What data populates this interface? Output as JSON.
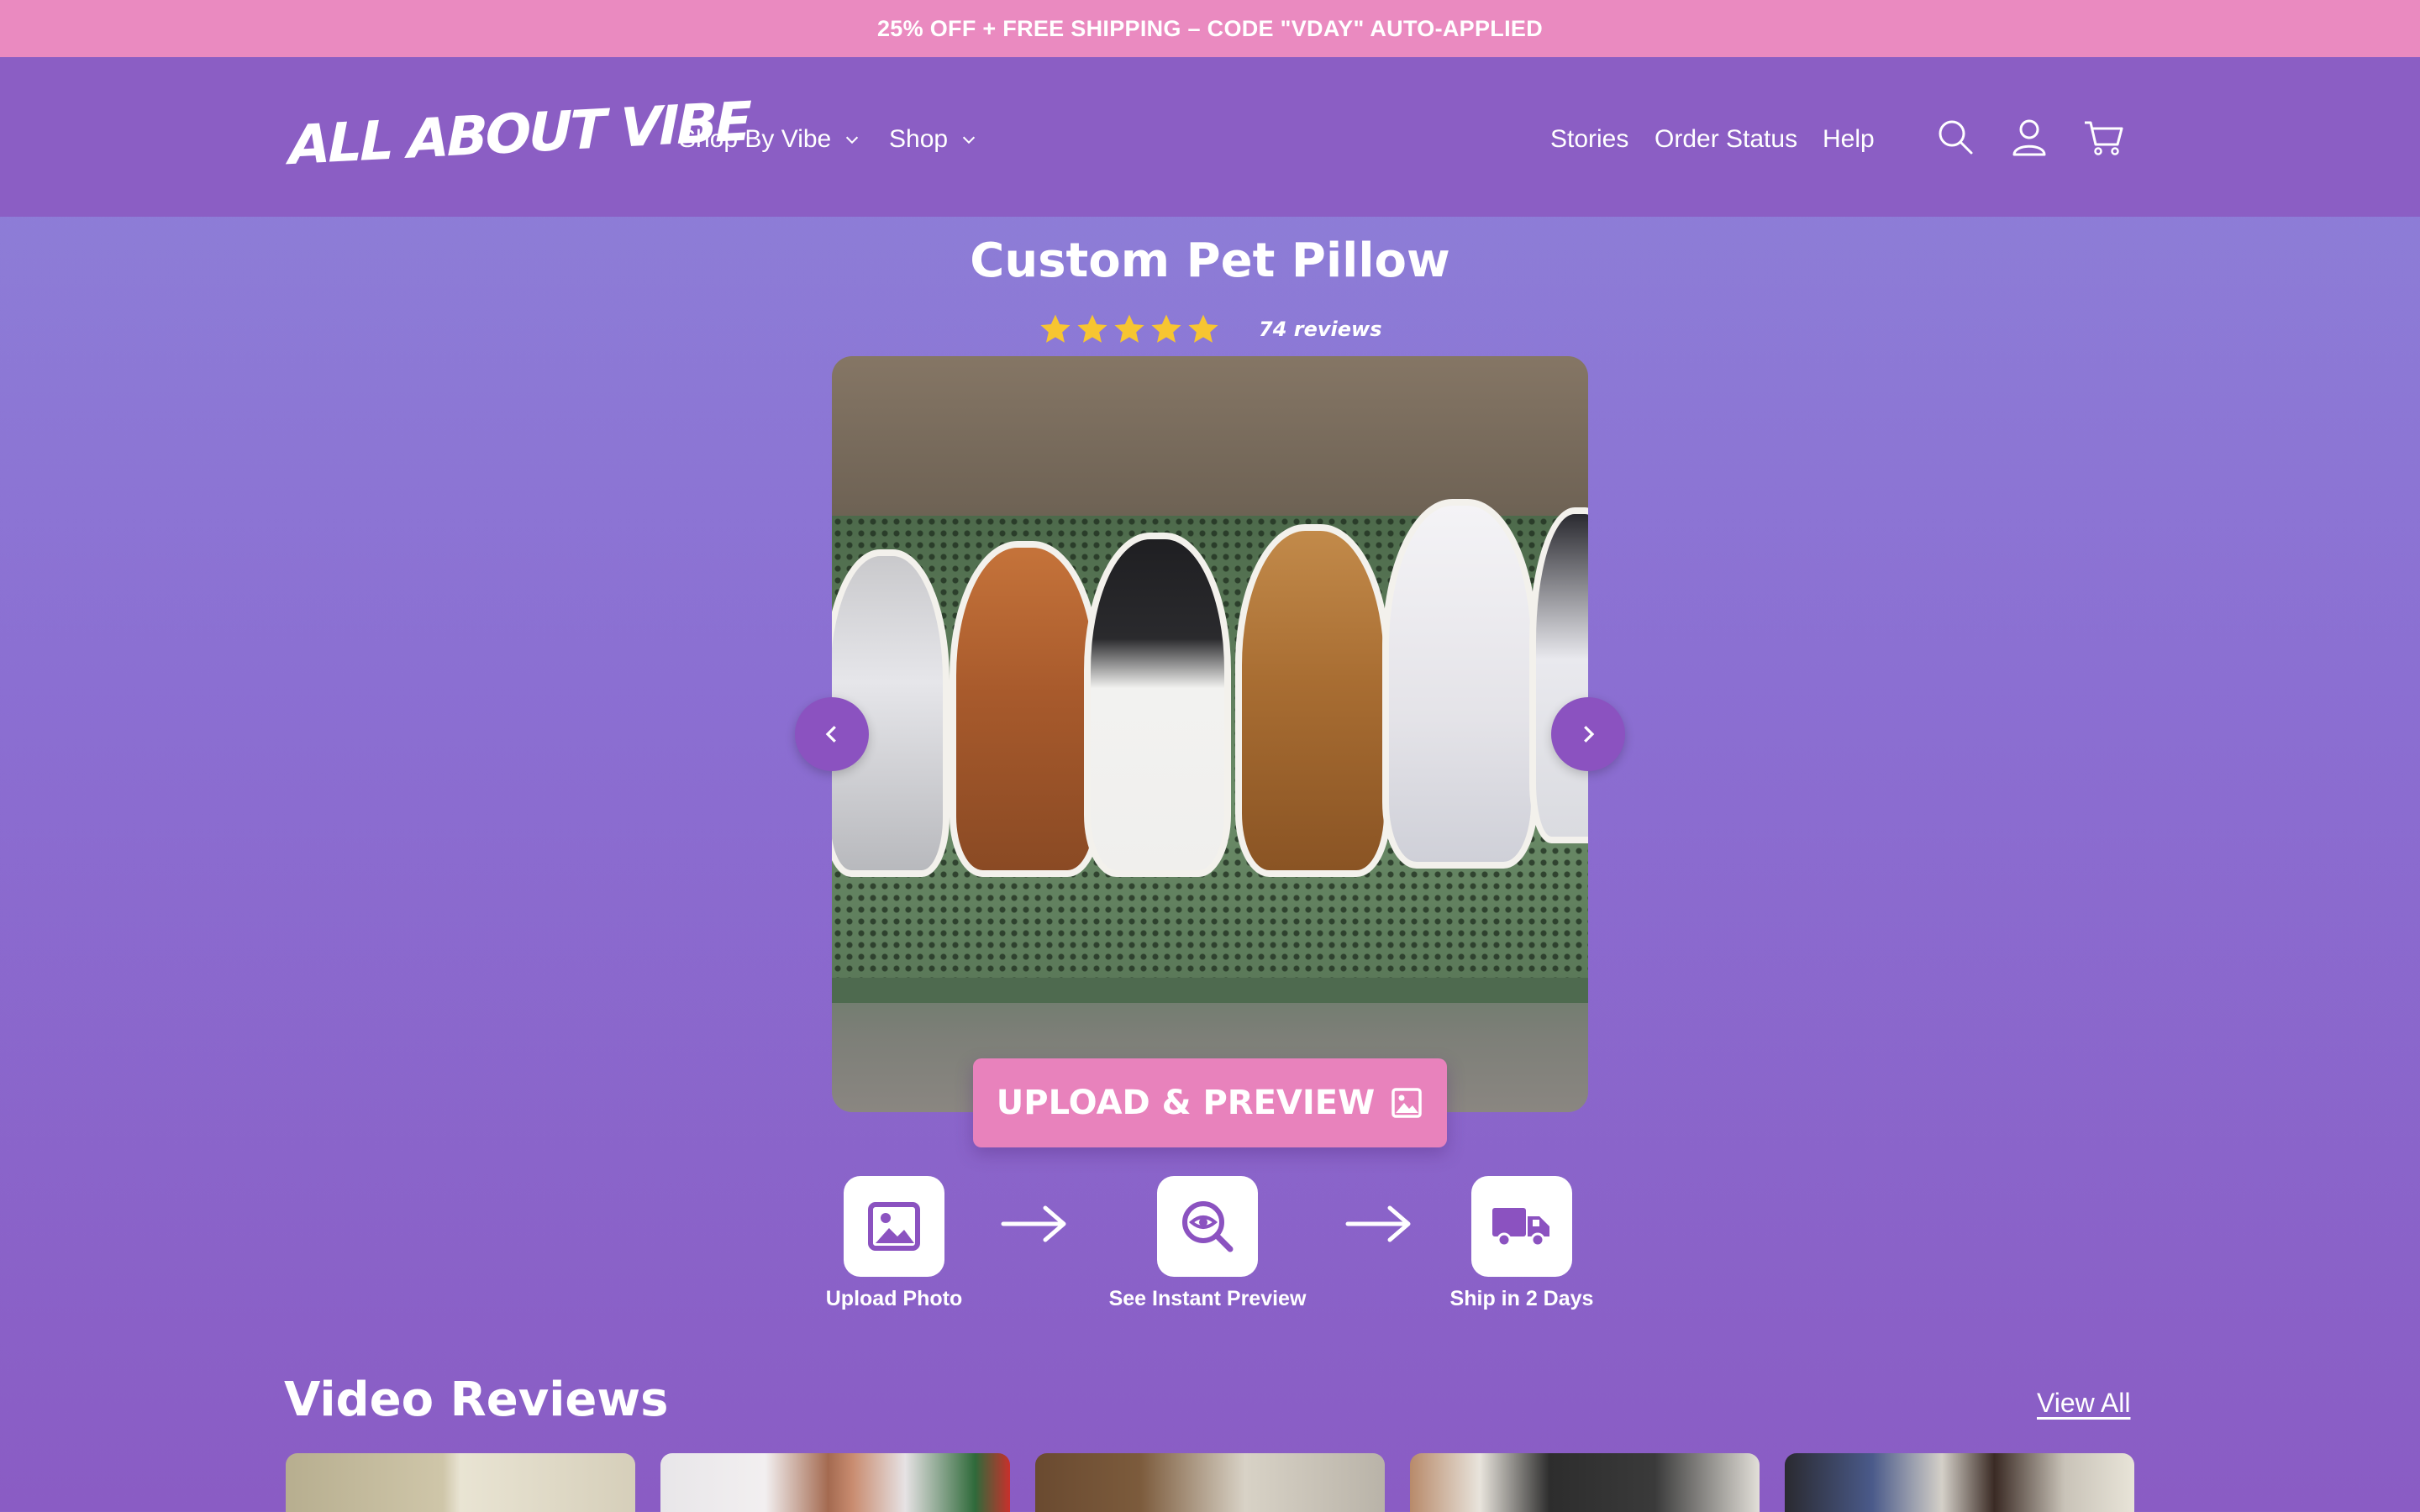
{
  "announcement": "25% OFF + FREE SHIPPING – CODE \"VDAY\" AUTO-APPLIED",
  "header": {
    "logo": "ALL ABOUT VIBE",
    "nav": [
      "Shop By Vibe",
      "Shop"
    ],
    "links": [
      "Stories",
      "Order Status",
      "Help"
    ],
    "icons": [
      "search-icon",
      "account-icon",
      "cart-icon"
    ]
  },
  "product": {
    "title": "Custom Pet Pillow",
    "stars": 5,
    "reviews": "74 reviews",
    "cta_label": "UPLOAD & PREVIEW"
  },
  "steps": [
    {
      "label": "Upload Photo",
      "icon": "image-icon"
    },
    {
      "label": "See Instant Preview",
      "icon": "eye-search-icon"
    },
    {
      "label": "Ship in 2 Days",
      "icon": "truck-icon"
    }
  ],
  "video_reviews": {
    "title": "Video Reviews",
    "view_all": "View All",
    "thumb_count": 5
  },
  "colors": {
    "announcement_bg": "#ea8ac0",
    "header_bg": "#8b5ec4",
    "accent_purple": "#8b52c0",
    "cta_pink": "#e882bc",
    "star_yellow": "#f7c531"
  }
}
